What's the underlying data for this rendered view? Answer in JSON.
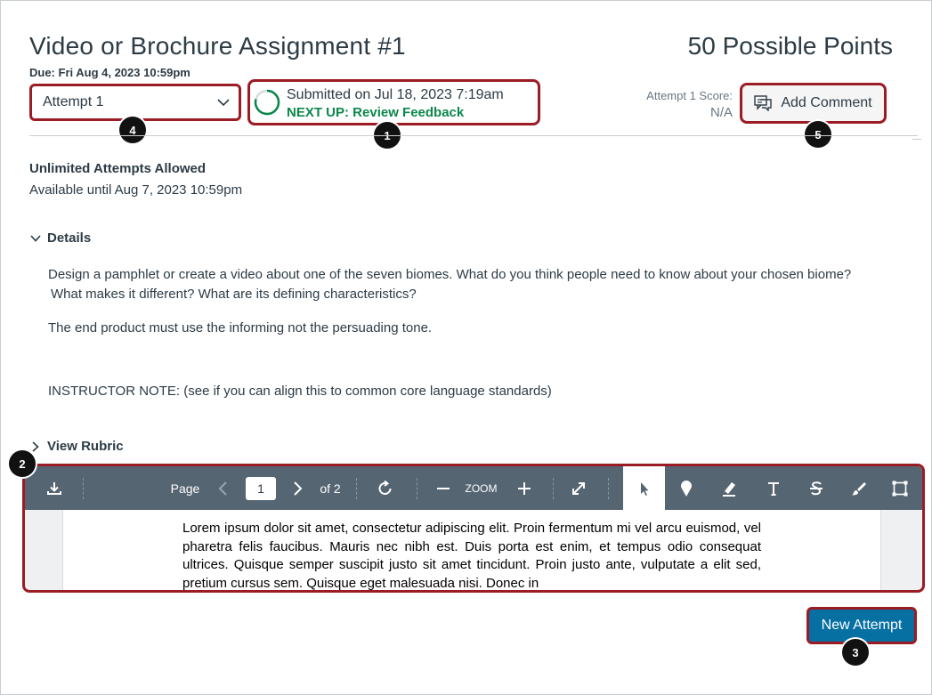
{
  "assignment": {
    "title": "Video or Brochure Assignment #1",
    "due": "Due: Fri Aug 4, 2023 10:59pm",
    "points": "50 Possible Points"
  },
  "attempt_select": {
    "value": "Attempt 1"
  },
  "submission": {
    "status": "Submitted on Jul 18, 2023 7:19am",
    "next_up": "NEXT UP: Review Feedback"
  },
  "score": {
    "label": "Attempt 1 Score:",
    "value": "N/A"
  },
  "add_comment": {
    "label": "Add Comment"
  },
  "attempts_info": {
    "unlimited": "Unlimited Attempts Allowed",
    "available": "Available until Aug 7, 2023 10:59pm"
  },
  "details": {
    "toggle_label": "Details",
    "paragraph1_line1": "Design a pamphlet or create a video about one of the seven biomes. What do you think people need to know about your chosen biome?",
    "paragraph1_line2": "What makes it different? What are its defining characteristics?",
    "paragraph2": "The end product must use the informing not the persuading tone.",
    "instructor_note": "INSTRUCTOR NOTE: (see if you can align this to common core language standards)"
  },
  "rubric": {
    "toggle_label": "View Rubric"
  },
  "viewer": {
    "page_label": "Page",
    "page_current": "1",
    "page_total": "of 2",
    "zoom_label": "ZOOM",
    "pdf_text": "Lorem ipsum dolor sit amet, consectetur adipiscing elit. Proin fermentum mi vel arcu euismod, vel pharetra felis faucibus. Mauris nec nibh est. Duis porta est enim, et tempus odio consequat ultrices. Quisque semper suscipit justo sit amet tincidunt. Proin justo ante, vulputate a elit sed, pretium cursus sem. Quisque eget malesuada nisi. Donec in"
  },
  "new_attempt": {
    "label": "New Attempt"
  },
  "callouts": [
    "1",
    "2",
    "3",
    "4",
    "5"
  ],
  "colors": {
    "highlight_border": "#9b1c25",
    "next_up_green": "#0b874b",
    "primary_button": "#0770a3",
    "toolbar_bg": "#556572"
  }
}
